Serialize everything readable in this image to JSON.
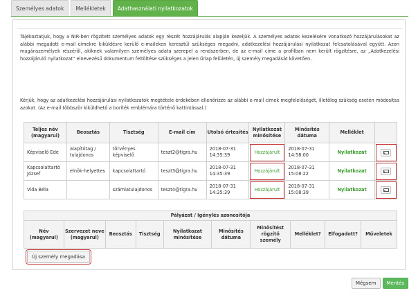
{
  "tabs": [
    {
      "label": "Személyes adatok",
      "active": false
    },
    {
      "label": "Mellékletek",
      "active": false
    },
    {
      "label": "Adathasználati nyilatkozatok",
      "active": true
    }
  ],
  "intro": {
    "p1": "Tájékoztatjuk, hogy a NIR-ben rögzített személyes adatok egy részét hozzájárulás alapján kezeljük. A személyes adatok kezelésére vonatkozó hozzájárulásokat az alábbi megadott e-mail címekre kiküldésre kerülő e-maileken keresztül szükséges megadni, adatkezelési hozzájárulási nyilatkozat felcsatolásával együtt. Azon magánszemélyek részéről, akiknek valamilyen személyes adata szerepel a rendszerben, de az e-mail címe a profilban nem került rögzítésre, az „Adatkezelési hozzájáruló nyilatkozat” elnevezésű dokumentum feltöltése szükséges a jelen űrlap felületén, új személy megadását követően.",
    "p2": "Kérjük, hogy az adatkezelési hozzájárulási nyilatkozatok megtétele érdekében ellenőrizze az alábbi e-mail címek megfelelőségét, illetőleg szükség esetén módosítsa azokat. (Az e-mail többször kiküldhető a boríték emblémára történő kattintással.)"
  },
  "persons_table": {
    "headers": [
      "Teljes név (magyarul)",
      "Beosztás",
      "Tisztség",
      "E-mail cím",
      "Utolsó értesítés",
      "Nyilatkozat minősítése",
      "Minősítés dátuma",
      "Melléklet",
      ""
    ],
    "rows": [
      {
        "name": "Képviselő Ede",
        "position": "alapítótag / tulajdonos",
        "title": "törvényes képviselő",
        "email": "teszt2@tigra.hu",
        "last_date": "2018-07-31",
        "last_time": "14:35:39",
        "status": "Hozzájárult",
        "q_date": "2018-07-31",
        "q_time": "14:58:00",
        "attachment": "Nyilatkozat",
        "icon": "envelope-icon"
      },
      {
        "name": "Kapcsolattartó József",
        "position": "elnök-helyettes",
        "title": "kapcsolattartó",
        "email": "teszt3@tigra.hu",
        "last_date": "2018-07-31",
        "last_time": "14:35:39",
        "status": "Hozzájárult",
        "q_date": "2018-07-31",
        "q_time": "15:08:22",
        "attachment": "Nyilatkozat",
        "icon": "envelope-icon"
      },
      {
        "name": "Vida Béla",
        "position": "",
        "title": "számlatulajdonos",
        "email": "teszt4@tigra.hu",
        "last_date": "2018-07-31",
        "last_time": "14:35:39",
        "status": "Hozzájárult",
        "q_date": "2018-07-31",
        "q_time": "15:08:39",
        "attachment": "Nyilatkozat",
        "icon": "envelope-icon"
      }
    ]
  },
  "app_table": {
    "title": "Pályázat / Igénylés azonosítója",
    "headers": [
      "Név (magyarul)",
      "Szervezet neve (magyarul)",
      "Beosztás",
      "Tisztség",
      "Nyilatkozat minősítése",
      "Minősítés dátuma",
      "Minősítést rögzítő személy",
      "Melléklet?",
      "Elfogadott?",
      "Műveletek"
    ]
  },
  "buttons": {
    "new_person": "Új személy megadása",
    "cancel": "Mégsem",
    "save": "Mentés"
  },
  "colors": {
    "accent": "#62b24c",
    "highlight": "#c63b3b"
  }
}
